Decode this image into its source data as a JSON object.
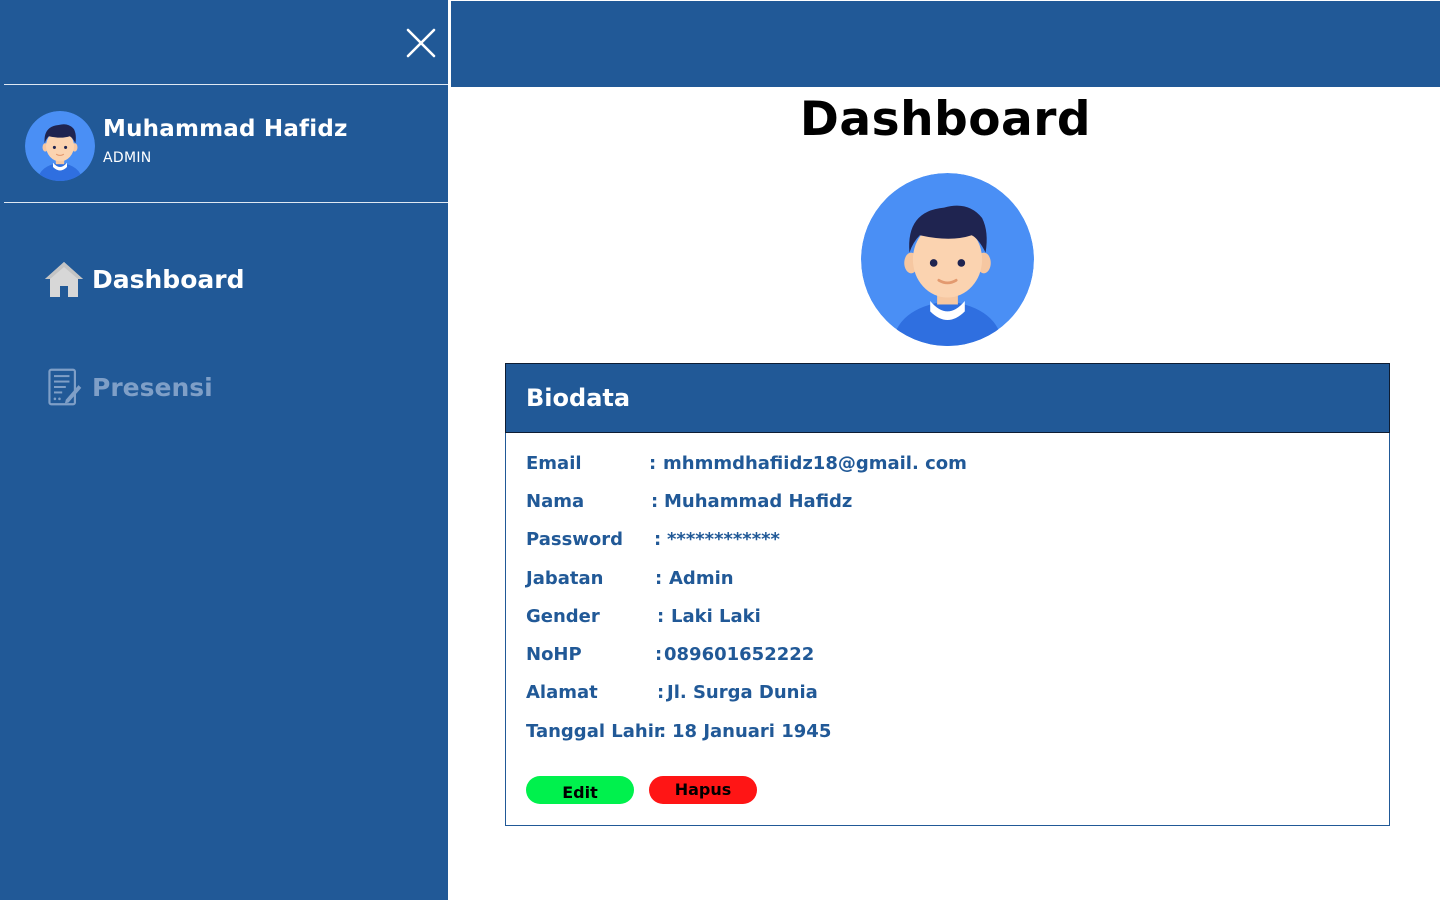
{
  "sidebar": {
    "profile": {
      "name": "Muhammad Hafidz",
      "role": "ADMIN"
    },
    "items": [
      {
        "label": "Dashboard",
        "icon": "home-icon",
        "active": true
      },
      {
        "label": "Presensi",
        "icon": "document-edit-icon",
        "active": false
      }
    ]
  },
  "main": {
    "title": "Dashboard",
    "biodata": {
      "title": "Biodata",
      "rows": [
        {
          "label": "Email",
          "sep": ":",
          "value": "mhmmdhafiidz18@gmail. com"
        },
        {
          "label": "Nama",
          "sep": ":",
          "value": "Muhammad Hafidz"
        },
        {
          "label": "Password",
          "sep": ":",
          "value": "************"
        },
        {
          "label": "Jabatan",
          "sep": ":",
          "value": "Admin"
        },
        {
          "label": "Gender",
          "sep": ":",
          "value": "Laki Laki"
        },
        {
          "label": "NoHP",
          "sep": ":",
          "value": "089601652222"
        },
        {
          "label": "Alamat",
          "sep": ":",
          "value": "Jl. Surga Dunia"
        },
        {
          "label": "Tanggal Lahir",
          "sep": ":",
          "value": "18 Januari 1945"
        }
      ],
      "edit_label": "Edit",
      "delete_label": "Hapus"
    }
  },
  "colors": {
    "primary": "#215997",
    "edit": "#00f14d",
    "delete": "#ff1515",
    "avatar_bg": "#4a8ff5"
  }
}
